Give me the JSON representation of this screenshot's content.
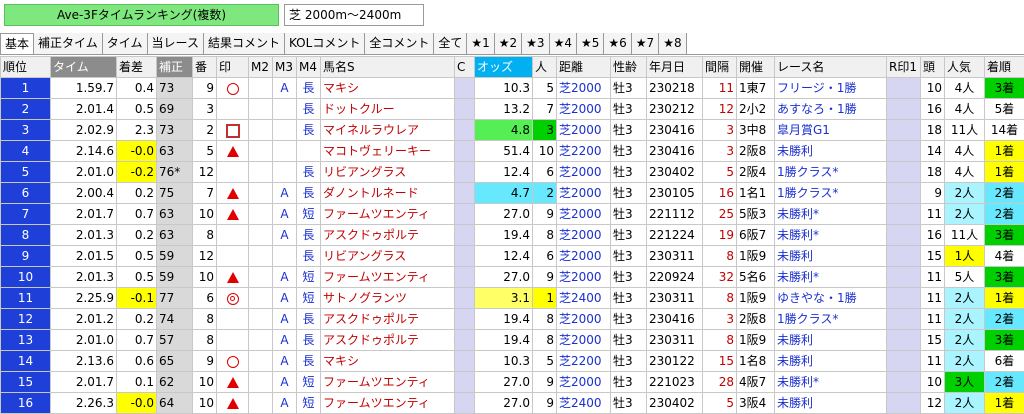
{
  "header": {
    "title_button": "Ave-3Fタイムランキング(複数)",
    "distance_filter": "芝 2000m～2400m"
  },
  "tabs": [
    "基本",
    "補正タイム",
    "タイム",
    "当レース",
    "結果コメント",
    "KOLコメント",
    "全コメント",
    "全て",
    "★1",
    "★2",
    "★3",
    "★4",
    "★5",
    "★6",
    "★7",
    "★8"
  ],
  "columns": [
    "順位",
    "タイム",
    "着差",
    "補正",
    "番",
    "印",
    "M2",
    "M3",
    "M4",
    "馬名S",
    "C",
    "オッズ",
    "人",
    "距離",
    "性齢",
    "年月日",
    "間隔",
    "開催",
    "レース名",
    "R印1",
    "頭",
    "人気",
    "着順"
  ],
  "rows": [
    {
      "rank": "1",
      "time": "1.59.7",
      "diff": "0.4",
      "hosei": "73",
      "ban": "9",
      "mark": "circ",
      "m4": "A",
      "m4b": "長",
      "name": "マキシ",
      "odds": "10.3",
      "pop": "5",
      "dist": "芝2000",
      "sex": "牡3",
      "date": "230218",
      "interval": "11",
      "kaisai": "1東7",
      "race": "フリージ・1勝",
      "heads": "10",
      "ninki": "4人",
      "chaku": "3着"
    },
    {
      "rank": "2",
      "time": "2.01.4",
      "diff": "0.5",
      "hosei": "69",
      "ban": "3",
      "mark": "",
      "m4": "",
      "m4b": "長",
      "name": "ドットクルー",
      "odds": "13.2",
      "pop": "7",
      "dist": "芝2000",
      "sex": "牡3",
      "date": "230212",
      "interval": "12",
      "kaisai": "2小2",
      "race": "あすなろ・1勝",
      "heads": "16",
      "ninki": "4人",
      "chaku": "5着"
    },
    {
      "rank": "3",
      "time": "2.02.9",
      "diff": "2.3",
      "hosei": "73",
      "ban": "2",
      "mark": "sq",
      "m4": "",
      "m4b": "長",
      "name": "マイネルラウレア",
      "odds": "4.8",
      "pop": "3",
      "dist": "芝2000",
      "sex": "牡3",
      "date": "230416",
      "interval": "3",
      "kaisai": "3中8",
      "race": "皐月賞G1",
      "heads": "18",
      "ninki": "11人",
      "chaku": "14着"
    },
    {
      "rank": "4",
      "time": "2.14.6",
      "diff": "-0.0",
      "hosei": "63",
      "ban": "5",
      "mark": "tri",
      "m4": "",
      "m4b": "",
      "name": "マコトヴェリーキー",
      "odds": "51.4",
      "pop": "10",
      "dist": "芝2200",
      "sex": "牡3",
      "date": "230416",
      "interval": "3",
      "kaisai": "2阪8",
      "race": "未勝利",
      "heads": "14",
      "ninki": "4人",
      "chaku": "1着"
    },
    {
      "rank": "5",
      "time": "2.01.0",
      "diff": "-0.2",
      "hosei": "76*",
      "ban": "12",
      "mark": "",
      "m4": "",
      "m4b": "長",
      "name": "リビアングラス",
      "odds": "12.4",
      "pop": "6",
      "dist": "芝2000",
      "sex": "牡3",
      "date": "230402",
      "interval": "5",
      "kaisai": "2阪4",
      "race": "1勝クラス*",
      "heads": "18",
      "ninki": "4人",
      "chaku": "1着"
    },
    {
      "rank": "6",
      "time": "2.00.4",
      "diff": "0.2",
      "hosei": "75",
      "ban": "7",
      "mark": "tri",
      "m4": "A",
      "m4b": "長",
      "name": "ダノントルネード",
      "odds": "4.7",
      "pop": "2",
      "dist": "芝2000",
      "sex": "牡3",
      "date": "230105",
      "interval": "16",
      "kaisai": "1名1",
      "race": "1勝クラス*",
      "heads": "9",
      "ninki": "2人",
      "chaku": "2着"
    },
    {
      "rank": "7",
      "time": "2.01.7",
      "diff": "0.7",
      "hosei": "63",
      "ban": "10",
      "mark": "tri",
      "m4": "A",
      "m4b": "短",
      "name": "ファームツエンティ",
      "odds": "27.0",
      "pop": "9",
      "dist": "芝2000",
      "sex": "牡3",
      "date": "221112",
      "interval": "25",
      "kaisai": "5阪3",
      "race": "未勝利*",
      "heads": "11",
      "ninki": "2人",
      "chaku": "2着"
    },
    {
      "rank": "8",
      "time": "2.01.3",
      "diff": "0.2",
      "hosei": "63",
      "ban": "8",
      "mark": "",
      "m4": "A",
      "m4b": "長",
      "name": "アスクドゥポルテ",
      "odds": "19.4",
      "pop": "8",
      "dist": "芝2000",
      "sex": "牡3",
      "date": "221224",
      "interval": "19",
      "kaisai": "6阪7",
      "race": "未勝利*",
      "heads": "16",
      "ninki": "11人",
      "chaku": "3着"
    },
    {
      "rank": "9",
      "time": "2.01.5",
      "diff": "0.5",
      "hosei": "59",
      "ban": "12",
      "mark": "",
      "m4": "",
      "m4b": "長",
      "name": "リビアングラス",
      "odds": "12.4",
      "pop": "6",
      "dist": "芝2000",
      "sex": "牡3",
      "date": "230311",
      "interval": "8",
      "kaisai": "1阪9",
      "race": "未勝利",
      "heads": "15",
      "ninki": "1人",
      "chaku": "4着"
    },
    {
      "rank": "10",
      "time": "2.01.3",
      "diff": "0.5",
      "hosei": "59",
      "ban": "10",
      "mark": "tri",
      "m4": "A",
      "m4b": "短",
      "name": "ファームツエンティ",
      "odds": "27.0",
      "pop": "9",
      "dist": "芝2000",
      "sex": "牡3",
      "date": "220924",
      "interval": "32",
      "kaisai": "5名6",
      "race": "未勝利*",
      "heads": "11",
      "ninki": "5人",
      "chaku": "3着"
    },
    {
      "rank": "11",
      "time": "2.25.9",
      "diff": "-0.1",
      "hosei": "77",
      "ban": "6",
      "mark": "dcirc",
      "m4": "A",
      "m4b": "短",
      "name": "サトノグランツ",
      "odds": "3.1",
      "pop": "1",
      "dist": "芝2400",
      "sex": "牡3",
      "date": "230311",
      "interval": "8",
      "kaisai": "1阪9",
      "race": "ゆきやな・1勝",
      "heads": "11",
      "ninki": "2人",
      "chaku": "1着"
    },
    {
      "rank": "12",
      "time": "2.01.2",
      "diff": "0.2",
      "hosei": "74",
      "ban": "8",
      "mark": "",
      "m4": "A",
      "m4b": "長",
      "name": "アスクドゥポルテ",
      "odds": "19.4",
      "pop": "8",
      "dist": "芝2000",
      "sex": "牡3",
      "date": "230416",
      "interval": "3",
      "kaisai": "2阪8",
      "race": "1勝クラス*",
      "heads": "11",
      "ninki": "2人",
      "chaku": "2着"
    },
    {
      "rank": "13",
      "time": "2.01.0",
      "diff": "0.7",
      "hosei": "57",
      "ban": "8",
      "mark": "",
      "m4": "A",
      "m4b": "長",
      "name": "アスクドゥポルテ",
      "odds": "19.4",
      "pop": "8",
      "dist": "芝2000",
      "sex": "牡3",
      "date": "230311",
      "interval": "8",
      "kaisai": "1阪9",
      "race": "未勝利",
      "heads": "15",
      "ninki": "2人",
      "chaku": "3着"
    },
    {
      "rank": "14",
      "time": "2.13.6",
      "diff": "0.6",
      "hosei": "65",
      "ban": "9",
      "mark": "circ",
      "m4": "A",
      "m4b": "長",
      "name": "マキシ",
      "odds": "10.3",
      "pop": "5",
      "dist": "芝2200",
      "sex": "牡3",
      "date": "230122",
      "interval": "15",
      "kaisai": "1名8",
      "race": "未勝利",
      "heads": "11",
      "ninki": "2人",
      "chaku": "6着"
    },
    {
      "rank": "15",
      "time": "2.01.7",
      "diff": "0.1",
      "hosei": "62",
      "ban": "10",
      "mark": "tri",
      "m4": "A",
      "m4b": "短",
      "name": "ファームツエンティ",
      "odds": "27.0",
      "pop": "9",
      "dist": "芝2000",
      "sex": "牡3",
      "date": "221023",
      "interval": "28",
      "kaisai": "4阪7",
      "race": "未勝利*",
      "heads": "10",
      "ninki": "3人",
      "chaku": "2着"
    },
    {
      "rank": "16",
      "time": "2.26.3",
      "diff": "-0.0",
      "hosei": "64",
      "ban": "10",
      "mark": "tri",
      "m4": "A",
      "m4b": "短",
      "name": "ファームツエンティ",
      "odds": "27.0",
      "pop": "9",
      "dist": "芝2400",
      "sex": "牡3",
      "date": "230402",
      "interval": "5",
      "kaisai": "3阪4",
      "race": "未勝利",
      "heads": "12",
      "ninki": "2人",
      "chaku": "1着"
    }
  ],
  "colors": {
    "rank_bg": "#1e3fd8",
    "win": "#ffff00",
    "second": "#66e8ff",
    "third": "#00d000",
    "fav": "#00d000"
  }
}
